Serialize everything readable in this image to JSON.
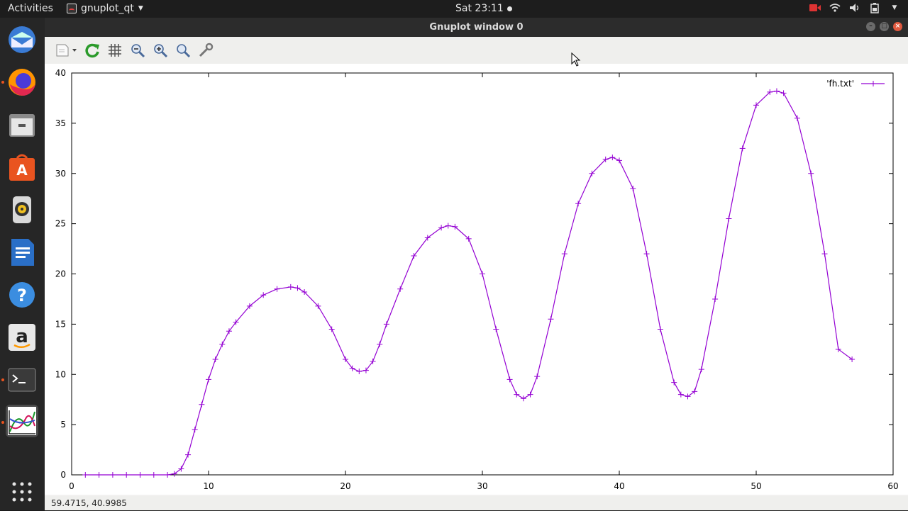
{
  "topbar": {
    "activities": "Activities",
    "app_name": "gnuplot_qt",
    "clock": "Sat 23:11"
  },
  "window": {
    "title": "Gnuplot window 0",
    "toolbar": [
      "export-icon",
      "replot-icon",
      "grid-icon",
      "zoom-previous-icon",
      "zoom-next-icon",
      "unzoom-icon",
      "settings-icon"
    ],
    "status": "59.4715, 40.9985"
  },
  "dock": [
    "thunderbird",
    "firefox",
    "files",
    "software-center",
    "rhythmbox",
    "writer",
    "help",
    "amazon",
    "terminal",
    "gnuplot"
  ],
  "chart_data": {
    "type": "line",
    "title": "",
    "xlabel": "",
    "ylabel": "",
    "xlim": [
      0,
      60
    ],
    "ylim": [
      0,
      40
    ],
    "xticks": [
      0,
      10,
      20,
      30,
      40,
      50,
      60
    ],
    "yticks": [
      0,
      5,
      10,
      15,
      20,
      25,
      30,
      35,
      40
    ],
    "grid": false,
    "legend": "top-right",
    "series": [
      {
        "name": "'fh.txt'",
        "color": "#9400d3",
        "marker": "+",
        "x": [
          1,
          2,
          3,
          4,
          5,
          6,
          7,
          7.5,
          8,
          8.5,
          9,
          9.5,
          10,
          10.5,
          11,
          11.5,
          12,
          13,
          14,
          15,
          16,
          16.5,
          17,
          18,
          19,
          20,
          20.5,
          21,
          21.5,
          22,
          22.5,
          23,
          24,
          25,
          26,
          27,
          27.5,
          28,
          29,
          30,
          31,
          32,
          32.5,
          33,
          33.5,
          34,
          35,
          36,
          37,
          38,
          39,
          39.5,
          40,
          41,
          42,
          43,
          44,
          44.5,
          45,
          45.5,
          46,
          47,
          48,
          49,
          50,
          51,
          51.5,
          52,
          53,
          54,
          55,
          56,
          57
        ],
        "y": [
          0,
          0,
          0,
          0,
          0,
          0,
          0,
          0.1,
          0.6,
          2,
          4.5,
          7,
          9.5,
          11.5,
          13,
          14.3,
          15.2,
          16.8,
          17.9,
          18.5,
          18.7,
          18.6,
          18.2,
          16.8,
          14.5,
          11.5,
          10.6,
          10.3,
          10.4,
          11.3,
          13,
          15,
          18.5,
          21.8,
          23.6,
          24.6,
          24.8,
          24.7,
          23.5,
          20,
          14.5,
          9.5,
          8,
          7.6,
          8,
          9.8,
          15.5,
          22,
          27,
          30,
          31.4,
          31.6,
          31.3,
          28.5,
          22,
          14.5,
          9.2,
          8,
          7.8,
          8.3,
          10.5,
          17.5,
          25.5,
          32.5,
          36.8,
          38.1,
          38.2,
          38,
          35.5,
          30,
          22,
          12.5,
          11.5
        ]
      }
    ]
  }
}
